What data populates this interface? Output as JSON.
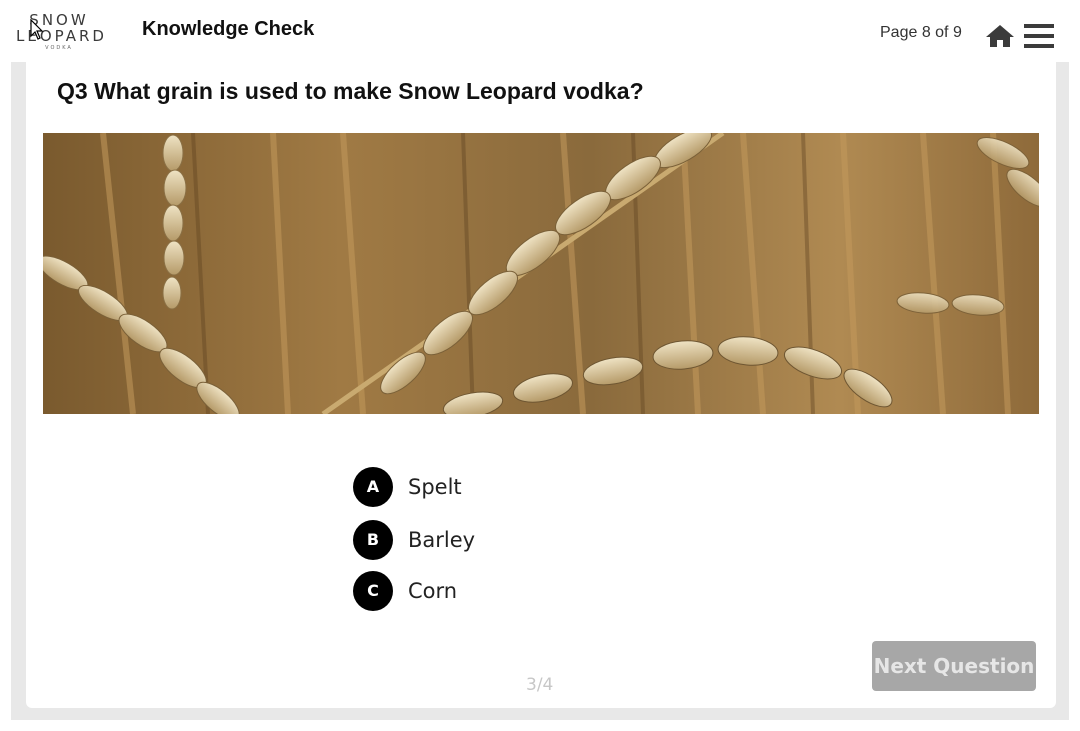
{
  "header": {
    "logo": {
      "line1": "SNOW",
      "line2": "LEOPARD",
      "line3": "VODKA"
    },
    "title": "Knowledge Check",
    "page_indicator": "Page 8 of 9",
    "home_icon": "home-icon",
    "menu_icon": "hamburger-menu-icon"
  },
  "question": {
    "text": "Q3 What grain is used to make Snow Leopard vodka?",
    "image": "wheat-ears-photo"
  },
  "options": [
    {
      "letter": "A",
      "label": "Spelt"
    },
    {
      "letter": "B",
      "label": "Barley"
    },
    {
      "letter": "C",
      "label": "Corn"
    }
  ],
  "footer": {
    "progress": "3/4",
    "next_label": "Next Question"
  },
  "colors": {
    "badge": "#000000",
    "next_button_disabled": "#a7a7a7",
    "frame": "#e8e8e8"
  }
}
